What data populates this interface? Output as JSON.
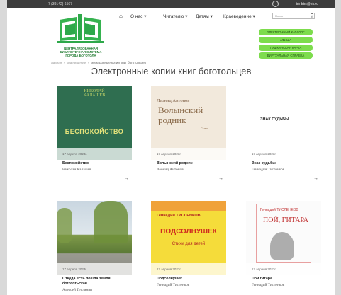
{
  "topbar": {
    "left_text": "7 (39142) 6567",
    "right_text": "bb-bbs@bk.ru"
  },
  "logo": {
    "line1": "ЦЕНТРАЛИЗОВАННАЯ",
    "line2": "БИБЛИОТЕЧНАЯ СИСТЕМА",
    "line3": "ГОРОДА БОГОТОЛА"
  },
  "nav": {
    "home_icon": "home-icon",
    "items": [
      "О нас ▾",
      "Читателю ▾",
      "Детям ▾",
      "Краеведение ▾"
    ]
  },
  "search": {
    "placeholder": "Поиск",
    "button_icon": "search-icon"
  },
  "green_buttons": [
    "ЭЛЕКТРОННЫЙ КАТАЛОГ",
    "АФИША",
    "ПУШКИНСКАЯ КАРТА",
    "ВИРТУАЛЬНАЯ СПРАВКА"
  ],
  "breadcrumb": [
    "Главная",
    "Краеведение",
    "Электронные копии книг боготольцев"
  ],
  "page_title": "Электронные копии книг боготольцев",
  "books": [
    {
      "date": "17 апреля 2023г.",
      "title": "Беспокойство",
      "author": "Николай Калашев",
      "cover_author": "НИКОЛАЙ\nКАЛАШЕВ",
      "cover_title": "БЕСПОКОЙСТВО"
    },
    {
      "date": "17 апреля 2023г.",
      "title": "Волынский родник",
      "author": "Леонид Антонов",
      "cover_author": "Леонид Антонов",
      "cover_title": "Волынский родник",
      "cover_sub": "Стихи"
    },
    {
      "date": "17 апреля 2023г.",
      "title": "Знак судьбы",
      "author": "Геннадий Тисленков",
      "cover_title": "ЗНАК СУДЬБЫ"
    },
    {
      "date": "17 апреля 2023г.",
      "title": "Откуда есть пошла земля богототьская",
      "author": "Алексей Теплянин"
    },
    {
      "date": "17 апреля 2023г.",
      "title": "Подсолнушек",
      "author": "Геннадий Тисленков",
      "cover_author": "Геннадий ТИСЛЕНКОВ",
      "cover_title": "ПОДСОЛНУШЕК",
      "cover_sub": "Стихи для детей"
    },
    {
      "date": "17 апреля 2023г.",
      "title": "Пой гитара",
      "author": "Геннадий Тисленков",
      "cover_author": "Геннадий ТИСЛЕНКОВ",
      "cover_title": "ПОЙ, ГИТАРА"
    }
  ],
  "arrow": "→"
}
